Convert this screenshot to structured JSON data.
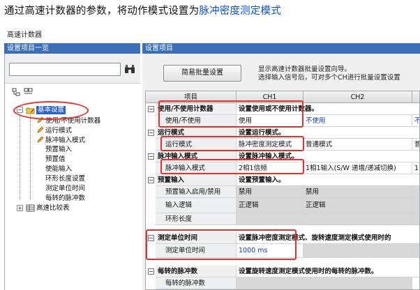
{
  "instruction": {
    "prefix": "通过高速计数器的参数，将动作模式设置为",
    "highlight": "脉冲密度测定模式"
  },
  "window_title": "高速计数器",
  "left_panel": {
    "header": "设置项目一览",
    "search_placeholder": "",
    "tree": {
      "root": "基本设置",
      "children": [
        "使用/不使用计数器",
        "运行模式",
        "脉冲输入模式",
        "预置输入",
        "预置值",
        "使能输入",
        "环形长度设置",
        "测定单位时间",
        "每转的脉冲数"
      ],
      "sibling": "高速比较表"
    }
  },
  "right_panel": {
    "header": "设置项目",
    "bulk_button": "简易批量设置",
    "bulk_desc_line1": "显示高速计数器批量设置向导。",
    "bulk_desc_line2": "选择输入信号后，可对多个CH进行批量设置设置"
  },
  "grid": {
    "col_item": "项目",
    "col_ch1": "CH1",
    "col_ch2": "CH2",
    "sections": [
      {
        "name": "使用/不使用计数器",
        "desc": "设置使用或不使用计数器。",
        "rows": [
          {
            "label": "使用/不使用",
            "ch1": "使用",
            "ch2": "不使用",
            "ch1_blue": false,
            "ch2_blue": true,
            "ch3": "不"
          }
        ]
      },
      {
        "name": "运行模式",
        "desc": "设置运行模式。",
        "rows": [
          {
            "label": "运行模式",
            "ch1": "脉冲密度测定模式",
            "ch2": "普通模式",
            "ch1_blue": false,
            "ch2_blue": false,
            "ch3": "普"
          }
        ]
      },
      {
        "name": "脉冲输入模式",
        "desc": "设置脉冲输入模式。",
        "rows": [
          {
            "label": "脉冲输入模式",
            "ch1": "2相1倍频",
            "ch2": "1相1输入(S/W 递增/递减切换)",
            "ch1_blue": false,
            "ch2_blue": false,
            "ch3": "1"
          }
        ]
      },
      {
        "name": "预置输入",
        "desc": "设置预置输入。",
        "rows": [
          {
            "label": "预置输入启用/禁用",
            "ch1": "禁用",
            "ch2": "禁用",
            "ch1_blue": false,
            "ch2_blue": false,
            "ch3": ""
          },
          {
            "label": "输入逻辑",
            "ch1": "正逻辑",
            "ch2": "正逻辑",
            "ch1_blue": false,
            "ch2_blue": false,
            "ch3": ""
          },
          {
            "label": "环形长度",
            "ch1": "",
            "ch2": "",
            "grey": true,
            "ch3": ""
          }
        ]
      },
      {
        "name": "测定单位时间",
        "desc": "设置脉冲密度测定模式、旋转速度测定模式使用时的",
        "rows": [
          {
            "label": "测定单位时间",
            "ch1": "1000 ms",
            "ch2": "",
            "ch1_blue": true,
            "ch2_blue": false,
            "ch3": ""
          }
        ]
      },
      {
        "name": "每转的脉冲数",
        "desc": "设置旋转速度测定模式使用时的每转的脉冲数。",
        "rows": [
          {
            "label": "每转的脉冲数",
            "ch1": "",
            "ch2": "",
            "ch3": ""
          }
        ]
      }
    ]
  },
  "colors": {
    "accent": "#3a6fb8",
    "highlight": "#e53030",
    "link_blue": "#1050c8"
  }
}
